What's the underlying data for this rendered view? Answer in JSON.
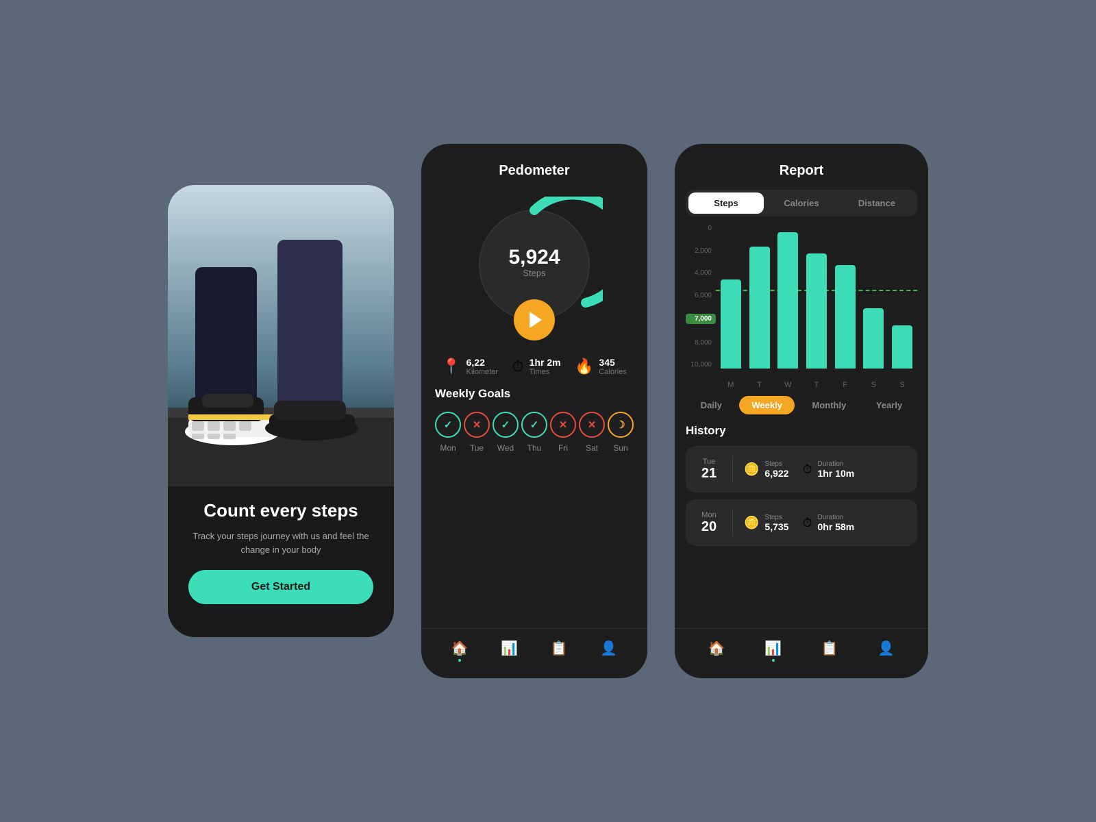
{
  "phone1": {
    "title": "Count every steps",
    "subtitle": "Track your steps journey with us and feel the change in your body",
    "cta": "Get Started"
  },
  "phone2": {
    "header": "Pedometer",
    "steps": "5,924",
    "steps_label": "Steps",
    "stats": [
      {
        "icon": "📍",
        "value": "6,22",
        "label": "Kilometer",
        "color": "#e74c3c"
      },
      {
        "icon": "⏱",
        "value": "1hr 2m",
        "label": "Times",
        "color": "#f5a623"
      },
      {
        "icon": "🔥",
        "value": "345",
        "label": "Calories",
        "color": "#e74c3c"
      }
    ],
    "weekly_goals_title": "Weekly Goals",
    "days": [
      {
        "name": "Mon",
        "status": "success",
        "symbol": "✓"
      },
      {
        "name": "Tue",
        "status": "fail",
        "symbol": "✕"
      },
      {
        "name": "Wed",
        "status": "success",
        "symbol": "✓"
      },
      {
        "name": "Thu",
        "status": "success",
        "symbol": "✓"
      },
      {
        "name": "Fri",
        "status": "fail",
        "symbol": "✕"
      },
      {
        "name": "Sat",
        "status": "fail",
        "symbol": "✕"
      },
      {
        "name": "Sun",
        "status": "sleep",
        "symbol": "☽"
      }
    ],
    "nav": [
      "🏠",
      "📊",
      "📋",
      "👤"
    ]
  },
  "phone3": {
    "header": "Report",
    "tabs": [
      "Steps",
      "Calories",
      "Distance"
    ],
    "active_tab": "Steps",
    "chart": {
      "y_labels": [
        "10,000",
        "8,000",
        "7,000",
        "6,000",
        "4,000",
        "2,000",
        "0"
      ],
      "goal_value": "7,000",
      "goal_pct": 53,
      "x_labels": [
        "M",
        "T",
        "W",
        "T",
        "F",
        "S",
        "S"
      ],
      "bars": [
        62,
        85,
        95,
        80,
        72,
        42,
        30
      ]
    },
    "periods": [
      "Daily",
      "Weekly",
      "Monthly",
      "Yearly"
    ],
    "active_period": "Weekly",
    "history_title": "History",
    "history": [
      {
        "day": "Tue",
        "num": "21",
        "steps_label": "Steps",
        "steps": "6,922",
        "duration_label": "Duration",
        "duration": "1hr 10m"
      },
      {
        "day": "Mon",
        "num": "20",
        "steps_label": "Steps",
        "steps": "5,735",
        "duration_label": "Duration",
        "duration": "0hr 58m"
      }
    ],
    "nav": [
      "🏠",
      "📊",
      "📋",
      "👤"
    ]
  }
}
